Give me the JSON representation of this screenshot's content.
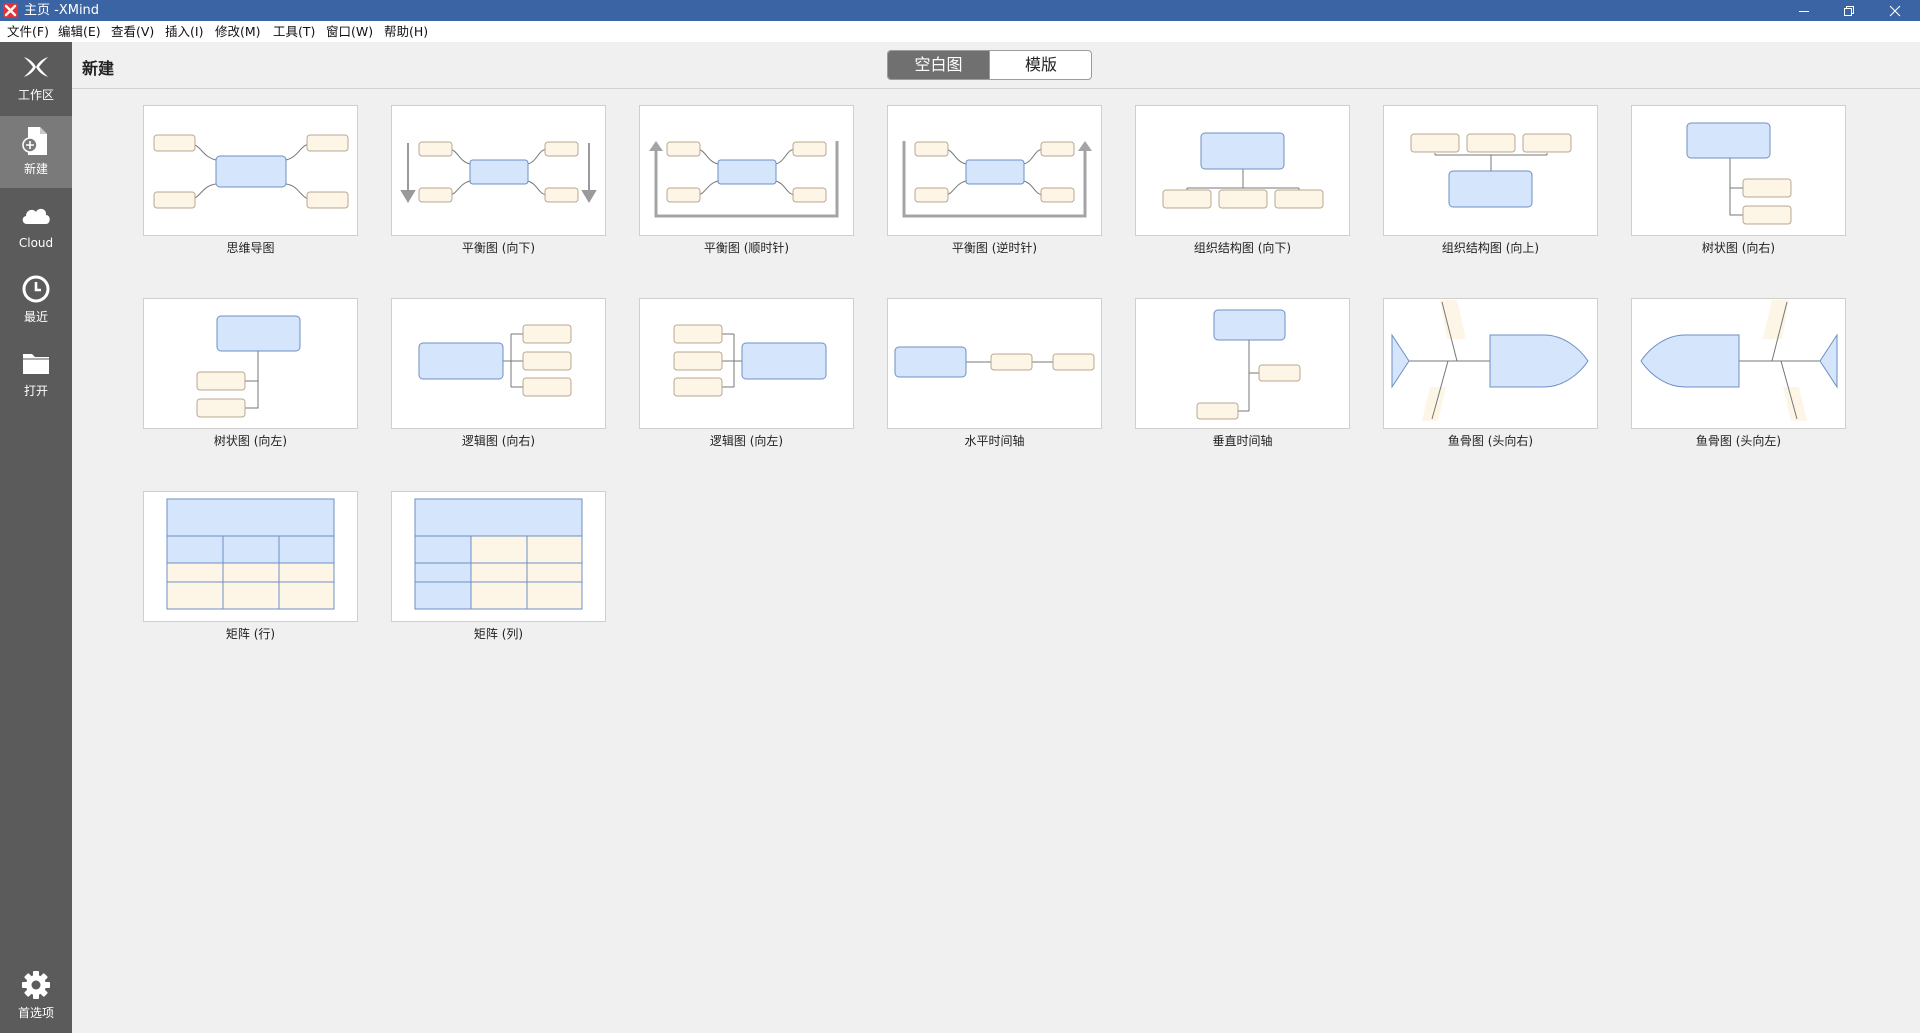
{
  "window": {
    "title": "主页 -XMind",
    "controls": [
      "minimize-icon",
      "restore-icon",
      "close-icon"
    ]
  },
  "menu": [
    "文件(F)",
    "编辑(E)",
    "查看(V)",
    "插入(I)",
    "修改(M)",
    "工具(T)",
    "窗口(W)",
    "帮助(H)"
  ],
  "sidebar": {
    "items": [
      {
        "label": "工作区",
        "icon": "xmind-logo-icon"
      },
      {
        "label": "新建",
        "icon": "new-file-icon",
        "active": true
      },
      {
        "label": "Cloud",
        "icon": "cloud-icon"
      },
      {
        "label": "最近",
        "icon": "clock-icon"
      },
      {
        "label": "打开",
        "icon": "folder-icon"
      }
    ],
    "bottom": {
      "label": "首选项",
      "icon": "gear-icon"
    }
  },
  "header": {
    "title": "新建",
    "tabs": [
      {
        "label": "空白图",
        "selected": true
      },
      {
        "label": "模版",
        "selected": false
      }
    ]
  },
  "templates": [
    {
      "label": "思维导图"
    },
    {
      "label": "平衡图 (向下)"
    },
    {
      "label": "平衡图 (顺时针)"
    },
    {
      "label": "平衡图 (逆时针)"
    },
    {
      "label": "组织结构图 (向下)"
    },
    {
      "label": "组织结构图 (向上)"
    },
    {
      "label": "树状图 (向右)"
    },
    {
      "label": "树状图 (向左)"
    },
    {
      "label": "逻辑图 (向右)"
    },
    {
      "label": "逻辑图 (向左)"
    },
    {
      "label": "水平时间轴"
    },
    {
      "label": "垂直时间轴"
    },
    {
      "label": "鱼骨图 (头向右)"
    },
    {
      "label": "鱼骨图 (头向左)"
    },
    {
      "label": "矩阵 (行)"
    },
    {
      "label": "矩阵 (列)"
    }
  ],
  "colors": {
    "titlebar": "#3a64a4",
    "sidebar": "#5b5b5b",
    "sidebar_active": "#7a7a7a",
    "central_topic_fill": "#d5e5fb",
    "central_topic_stroke": "#6e8fc4",
    "subtopic_fill": "#fdf5e6",
    "subtopic_stroke": "#b8a890"
  }
}
